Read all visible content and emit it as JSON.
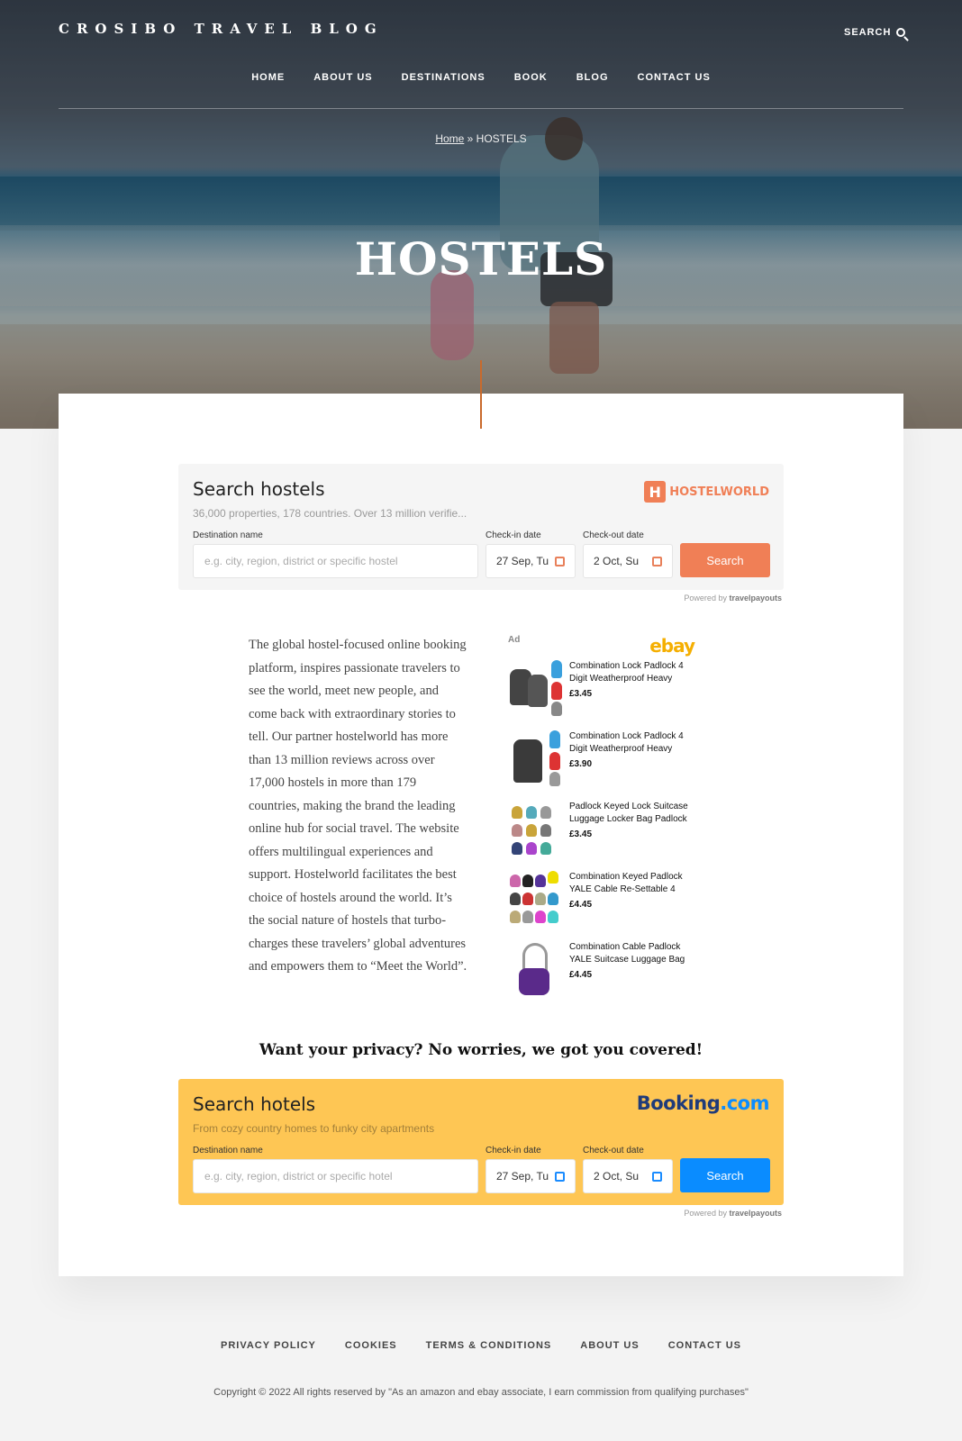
{
  "site": {
    "brand": "CROSIBO TRAVEL BLOG",
    "search_label": "SEARCH"
  },
  "nav": [
    "HOME",
    "ABOUT US",
    "DESTINATIONS",
    "BOOK",
    "BLOG",
    "CONTACT US"
  ],
  "breadcrumb": {
    "home": "Home",
    "separator": " » ",
    "current": "HOSTELS"
  },
  "hero": {
    "title": "HOSTELS"
  },
  "hostelworld_widget": {
    "title": "Search hostels",
    "subtitle": "36,000 properties, 178 countries. Over 13 million verifie...",
    "logo": "HOSTELWORLD",
    "destination_label": "Destination name",
    "destination_placeholder": "e.g. city, region, district or specific hostel",
    "checkin_label": "Check-in date",
    "checkin_value": "27 Sep, Tu",
    "checkout_label": "Check-out date",
    "checkout_value": "2 Oct, Su",
    "button": "Search",
    "powered_prefix": "Powered by",
    "powered_brand": "travelpayouts"
  },
  "intro_text": "The global hostel-focused online booking platform, inspires passionate travelers to see the world, meet new people, and come back with extraordinary stories to tell. Our partner hostelworld has more than 13 million reviews across over 17,000 hostels in more than 179 countries, making the brand the leading online hub for social travel. The website offers multilingual experiences and support. Hostelworld facilitates the best choice of hostels around the world. It’s the social nature of hostels that turbo-charges these travelers’ global adventures and empowers them to “Meet the World”.",
  "ad": {
    "label": "Ad",
    "logo": "ebay",
    "items": [
      {
        "title": "Combination Lock Padlock 4 Digit Weatherproof Heavy",
        "price": "£3.45"
      },
      {
        "title": "Combination Lock Padlock 4 Digit Weatherproof Heavy",
        "price": "£3.90"
      },
      {
        "title": "Padlock Keyed Lock Suitcase Luggage Locker Bag Padlock",
        "price": "£3.45"
      },
      {
        "title": "Combination Keyed Padlock YALE Cable Re-Settable 4",
        "price": "£4.45"
      },
      {
        "title": "Combination Cable Padlock YALE Suitcase Luggage Bag",
        "price": "£4.45"
      }
    ]
  },
  "privacy_heading": "Want your privacy? No worries, we got you covered!",
  "booking_widget": {
    "title": "Search hotels",
    "subtitle": "From cozy country homes to funky city apartments",
    "logo_main": "Booking",
    "logo_suffix": ".com",
    "destination_label": "Destination name",
    "destination_placeholder": "e.g. city, region, district or specific hotel",
    "checkin_label": "Check-in date",
    "checkin_value": "27 Sep, Tu",
    "checkout_label": "Check-out date",
    "checkout_value": "2 Oct, Su",
    "button": "Search",
    "powered_prefix": "Powered by",
    "powered_brand": "travelpayouts"
  },
  "footer": {
    "links": [
      "PRIVACY POLICY",
      "COOKIES",
      "TERMS & CONDITIONS",
      "ABOUT US",
      "CONTACT US"
    ],
    "copyright": "Copyright © 2022 All rights reserved by \"As an amazon and ebay associate, I earn commission from qualifying purchases\""
  },
  "colors": {
    "accent": "#c96a2c",
    "hostelworld": "#f07f56",
    "booking_bg": "#fec654",
    "booking_blue": "#0a8cff"
  }
}
